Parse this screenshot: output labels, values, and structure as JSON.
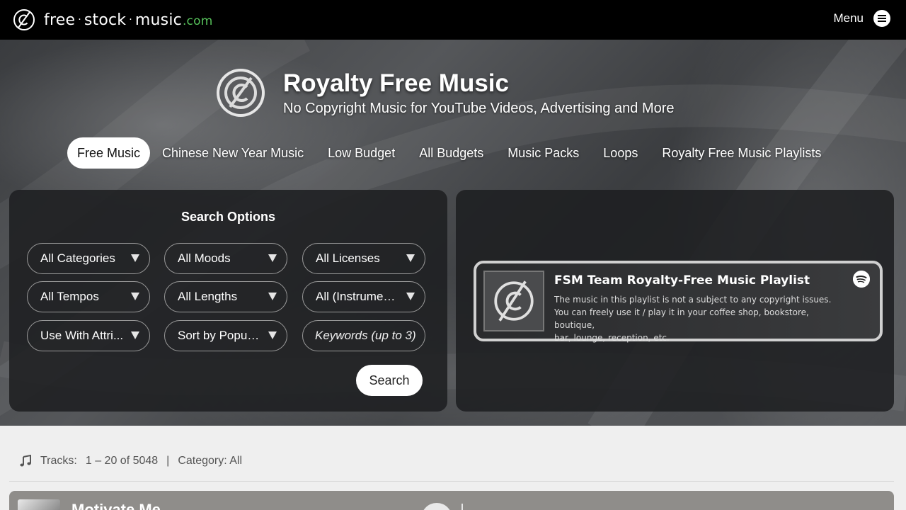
{
  "site": {
    "logo_name": "free",
    "logo_mid": "stock",
    "logo_end": "music",
    "logo_tld": ".com",
    "menu_label": "Menu"
  },
  "hero": {
    "title": "Royalty Free Music",
    "subtitle": "No Copyright Music for YouTube Videos, Advertising and More"
  },
  "nav": [
    {
      "label": "Free Music",
      "active": true
    },
    {
      "label": "Chinese New Year Music"
    },
    {
      "label": "Low Budget"
    },
    {
      "label": "All Budgets"
    },
    {
      "label": "Music Packs"
    },
    {
      "label": "Loops"
    },
    {
      "label": "Royalty Free Music Playlists"
    }
  ],
  "search": {
    "title": "Search Options",
    "selects": [
      {
        "label": "All Categories"
      },
      {
        "label": "All Moods"
      },
      {
        "label": "All Licenses"
      },
      {
        "label": "All Tempos"
      },
      {
        "label": "All Lengths"
      },
      {
        "label": "All (Instrumen..."
      },
      {
        "label": "Use With Attri..."
      },
      {
        "label": "Sort by Popula..."
      }
    ],
    "keywords_placeholder": "Keywords (up to 3)",
    "button_label": "Search"
  },
  "playlist": {
    "title": "FSM Team Royalty-Free Music Playlist",
    "description_1": "The music in this playlist is not a subject to any copyright issues.",
    "description_2": "You can freely use it / play it in your coffee shop, bookstore, boutique,",
    "description_3": "bar, lounge, reception, etc."
  },
  "tracks": {
    "label": "Tracks:",
    "range": "1 – 20 of 5048",
    "separator": "|",
    "category": "Category: All"
  },
  "first_track": {
    "title": "Motivate Me"
  },
  "colors": {
    "topbar": "#000000",
    "accent_green": "#57c25b",
    "panel": "#1e1f21"
  }
}
